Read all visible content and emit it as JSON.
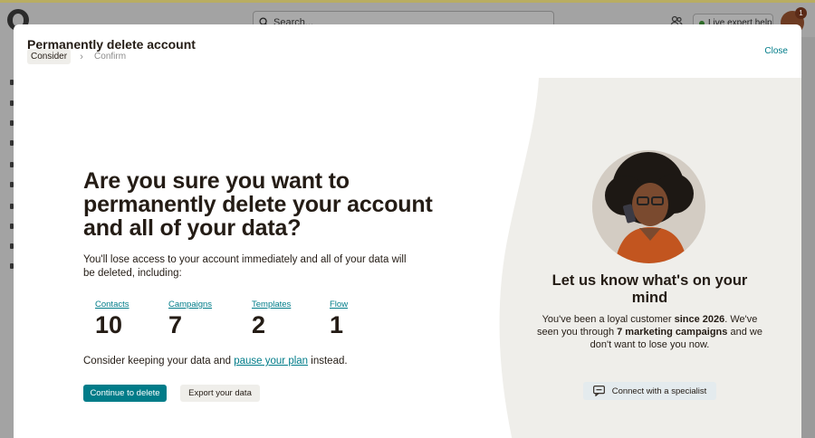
{
  "app": {
    "search_placeholder": "Search...",
    "expert_help_label": "Live expert help",
    "notification_count": "1"
  },
  "modal": {
    "title": "Permanently delete account",
    "breadcrumb": {
      "step1": "Consider",
      "step2": "Confirm"
    },
    "close_label": "Close",
    "headline": "Are you sure you want to permanently delete your account and all of your data?",
    "subtext": "You'll lose access to your account immediately and all of your data will be deleted, including:",
    "stats": [
      {
        "label": "Contacts",
        "value": "10"
      },
      {
        "label": "Campaigns",
        "value": "7"
      },
      {
        "label": "Templates",
        "value": "2"
      },
      {
        "label": "Flow",
        "value": "1"
      }
    ],
    "keep": {
      "prefix": "Consider keeping your data and",
      "link": "pause your plan",
      "suffix": "instead."
    },
    "buttons": {
      "continue": "Continue to delete",
      "export": "Export your data"
    },
    "right": {
      "title": "Let us know what's on your mind",
      "text": {
        "p1": "You've been a loyal customer",
        "b1": "since 2026",
        "p2": ". We've seen you through",
        "b2": "7 marketing campaigns",
        "p3": "and we don't want to lose you now."
      },
      "connect_label": "Connect with a specialist"
    }
  },
  "colors": {
    "accent": "#007c89",
    "panel_bg": "#efeeea",
    "text": "#241c15"
  },
  "icons": [
    "search-icon",
    "people-icon",
    "chevron-right-icon",
    "chat-icon"
  ]
}
